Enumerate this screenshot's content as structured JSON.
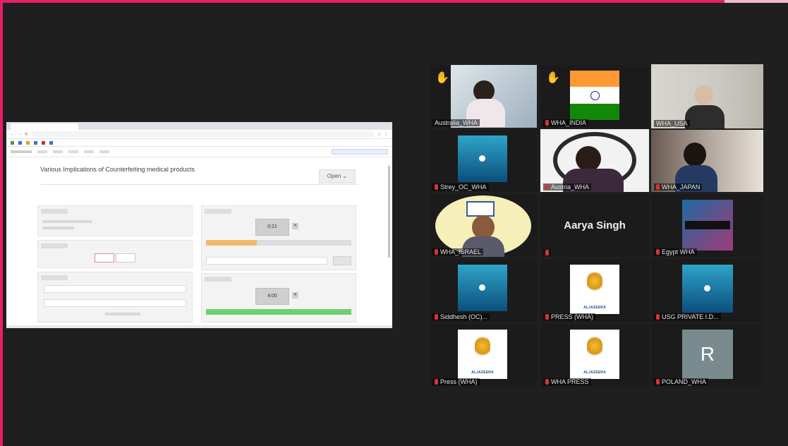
{
  "shared_screen": {
    "browser_tab": "",
    "url": "",
    "document_title": "Various Implications of Counterfeiting medical products",
    "open_button": "Open",
    "timer_1": "0:21",
    "timer_2": "4:00",
    "progress_1": 0.35,
    "progress_2": 1.0,
    "bar_colors": {
      "timer_1": "#f0b96b",
      "timer_2": "#6fcf73"
    }
  },
  "gallery": {
    "tiles": [
      {
        "name": "Australia_WHA",
        "hand": true,
        "type": "camera"
      },
      {
        "name": "WHA_INDIA",
        "hand": true,
        "type": "flag"
      },
      {
        "name": "WHA_USA",
        "type": "camera",
        "active": true
      },
      {
        "name": "Strey_OC_WHA",
        "type": "video-thumb"
      },
      {
        "name": "Austria_WHA",
        "type": "camera"
      },
      {
        "name": "WHA_JAPAN",
        "type": "camera"
      },
      {
        "name": "WHA_ISRAEL",
        "type": "camera"
      },
      {
        "name": "Aarya Singh",
        "type": "name-only"
      },
      {
        "name": "Egypt WHA",
        "type": "video-thumb"
      },
      {
        "name": "Siddhesh (OC)...",
        "type": "video-thumb"
      },
      {
        "name": "PRESS (WHA)",
        "type": "aljazeera"
      },
      {
        "name": "USG PRIVATE I.D...",
        "type": "video-thumb"
      },
      {
        "name": "Press (WHA)",
        "type": "aljazeera"
      },
      {
        "name": "WHA PRESS",
        "type": "aljazeera"
      },
      {
        "name": "POLAND_WHA",
        "type": "avatar",
        "initial": "R"
      }
    ]
  },
  "brand_text": "ALJAZEERA",
  "colors": {
    "frame_accent": "#e8206a",
    "active_speaker": "#b9d64a",
    "mic_muted": "#e03030"
  }
}
